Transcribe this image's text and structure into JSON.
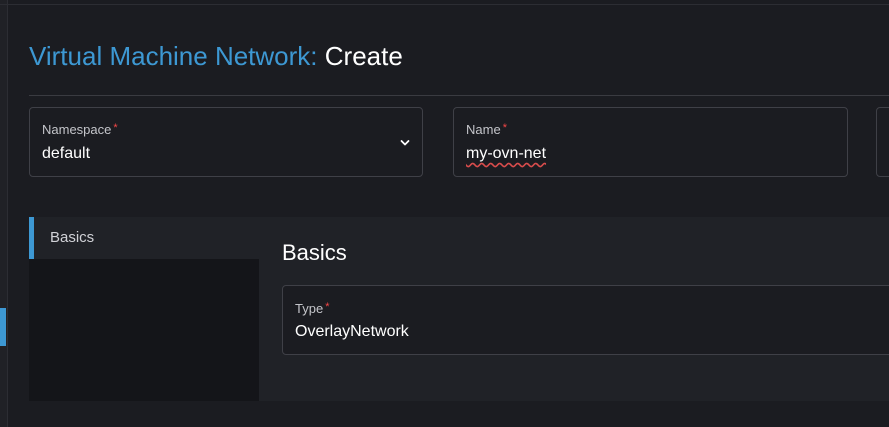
{
  "header": {
    "title_crumb": "Virtual Machine Network:",
    "title_action": "Create"
  },
  "form": {
    "namespace": {
      "label": "Namespace",
      "required_marker": "*",
      "value": "default"
    },
    "name": {
      "label": "Name",
      "required_marker": "*",
      "value": "my-ovn-net"
    }
  },
  "tabs": [
    {
      "label": "Basics",
      "active": true
    }
  ],
  "basics": {
    "section_title": "Basics",
    "type": {
      "label": "Type",
      "required_marker": "*",
      "value": "OverlayNetwork"
    }
  },
  "colors": {
    "accent": "#3d98d3",
    "background": "#1b1c21",
    "required": "#f64747"
  },
  "icons": {
    "namespace_dropdown": "chevron-down-icon"
  }
}
